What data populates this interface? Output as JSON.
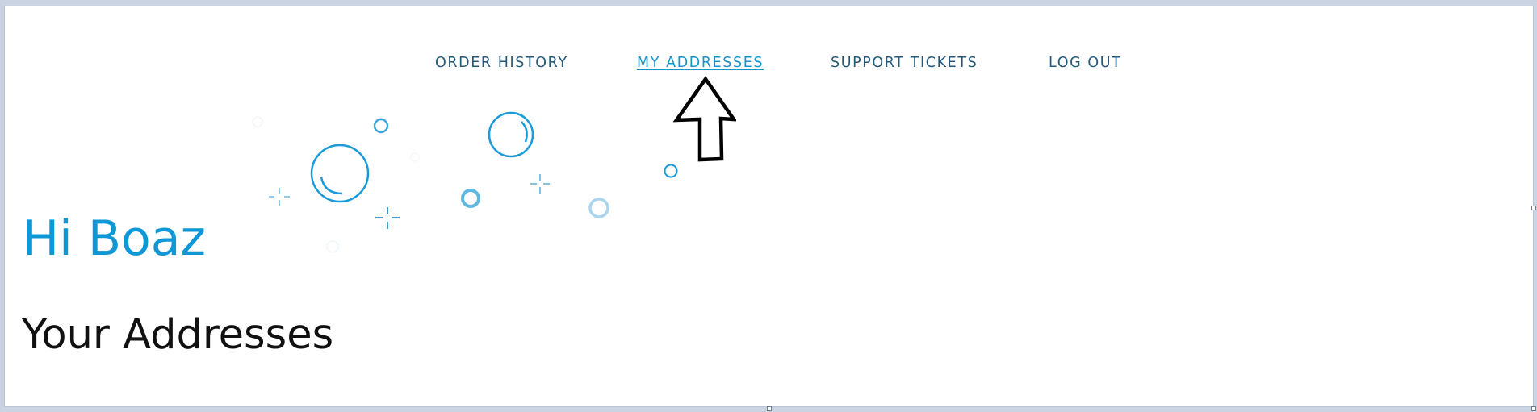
{
  "nav": {
    "items": [
      {
        "label": "ORDER HISTORY"
      },
      {
        "label": "MY ADDRESSES",
        "active": true
      },
      {
        "label": "SUPPORT TICKETS"
      },
      {
        "label": "LOG OUT"
      }
    ]
  },
  "greeting": "Hi Boaz",
  "page_title": "Your Addresses",
  "colors": {
    "accent": "#0f97d6",
    "nav_text": "#235a7c",
    "nav_active": "#1593cc",
    "bubbles": "#1a9ad9"
  },
  "icons": {
    "arrow": "up-arrow-icon",
    "decoration": "bubbles-decoration"
  }
}
